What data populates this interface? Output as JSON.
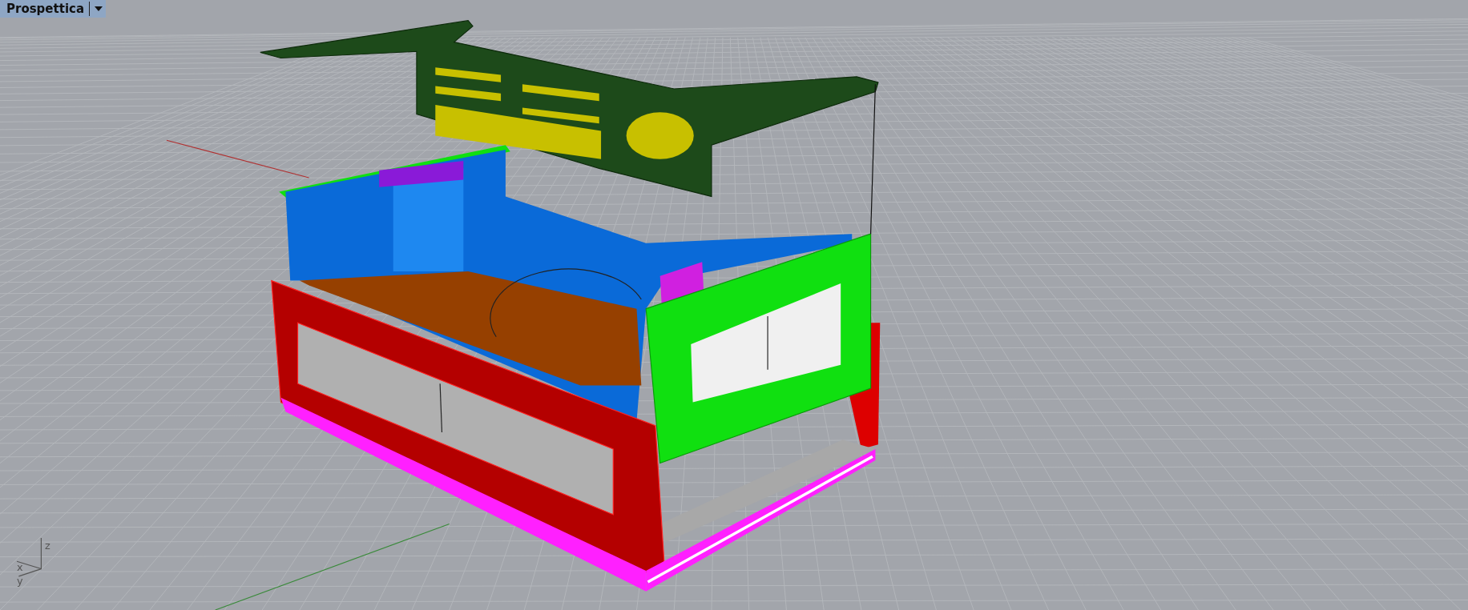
{
  "viewport": {
    "title": "Prospettica",
    "axis_labels": [
      "z",
      "x",
      "y"
    ]
  }
}
